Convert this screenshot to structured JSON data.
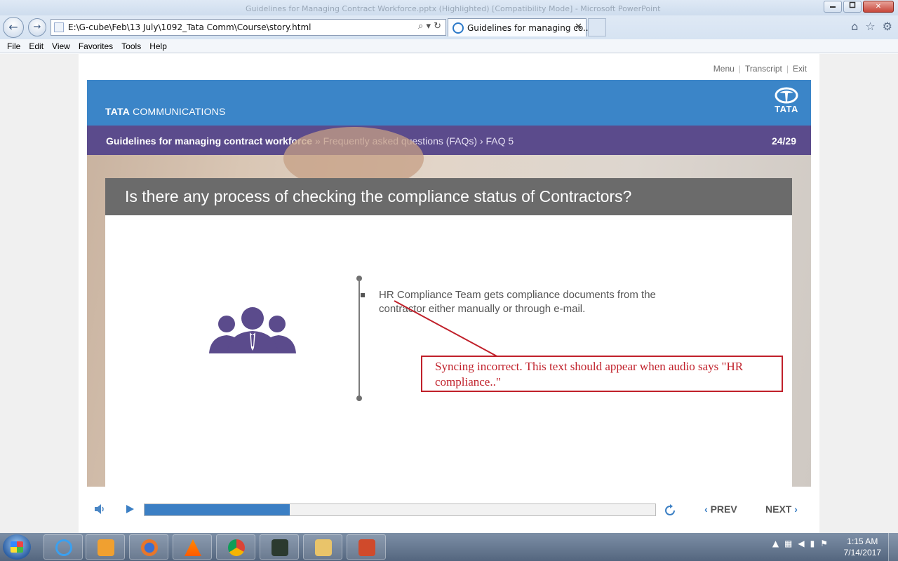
{
  "window": {
    "title": "Guidelines for Managing Contract Workforce.pptx (Highlighted) [Compatibility Mode] - Microsoft PowerPoint",
    "min_icon": "minimize-icon",
    "max_icon": "maximize-icon",
    "close_glyph": "✕"
  },
  "browser": {
    "back_glyph": "←",
    "forward_glyph": "→",
    "address": "E:\\G-cube\\Feb\\13 July\\1092_Tata Comm\\Course\\story.html",
    "address_icons": "⌕ ▾ ↻",
    "tab_title": "Guidelines for managing co...",
    "tab_close": "✕",
    "toolbar_icons": [
      "home-icon",
      "favorites-star-icon",
      "settings-gear-icon"
    ],
    "menu": [
      "File",
      "Edit",
      "View",
      "Favorites",
      "Tools",
      "Help"
    ]
  },
  "player": {
    "links": {
      "menu": "Menu",
      "transcript": "Transcript",
      "exit": "Exit",
      "separator": "|"
    },
    "brand": {
      "tata": "TATA",
      "communications": "COMMUNICATIONS",
      "logo_word": "TATA"
    },
    "breadcrumb": {
      "course": "Guidelines for managing contract workforce",
      "sep1": " » ",
      "section": "Frequently asked questions (FAQs)",
      "sep2": " › ",
      "page": "FAQ 5"
    },
    "counter": "24/29",
    "question": "Is there any process of checking the compliance status of Contractors?",
    "bullet": "HR Compliance Team gets compliance documents from the contractor either manually or through e-mail.",
    "annotation": "Syncing incorrect. This text should appear when audio says \"HR compliance..\"",
    "progress": 0.285,
    "prev_label": "PREV",
    "next_label": "NEXT",
    "chev_left": "‹",
    "chev_right": "›"
  },
  "colors": {
    "banner_blue": "#3b85c8",
    "breadcrumb_purple": "#5b4b8c",
    "question_gray": "#6b6b6b",
    "icon_purple": "#5b4b8c",
    "annotation_red": "#c0202a",
    "progress_blue": "#3b7fc4"
  },
  "taskbar": {
    "apps": [
      "internet-explorer",
      "media-player",
      "firefox",
      "vlc",
      "chrome",
      "sublime",
      "file-explorer",
      "powerpoint"
    ],
    "clock_time": "1:15 AM",
    "clock_date": "7/14/2017"
  }
}
